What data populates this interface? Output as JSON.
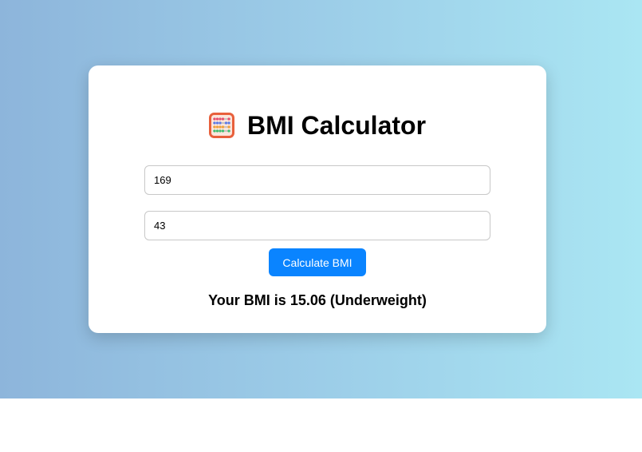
{
  "colors": {
    "background_gradient_start": "#8db5db",
    "background_gradient_end": "#aae6f3",
    "card": "#ffffff",
    "button": "#0a84ff",
    "button_text": "#ffffff"
  },
  "header": {
    "icon": "abacus-icon",
    "title": "BMI Calculator"
  },
  "form": {
    "height_value": "169",
    "weight_value": "43",
    "calculate_label": "Calculate BMI"
  },
  "result": {
    "text": "Your BMI is 15.06 (Underweight)"
  }
}
